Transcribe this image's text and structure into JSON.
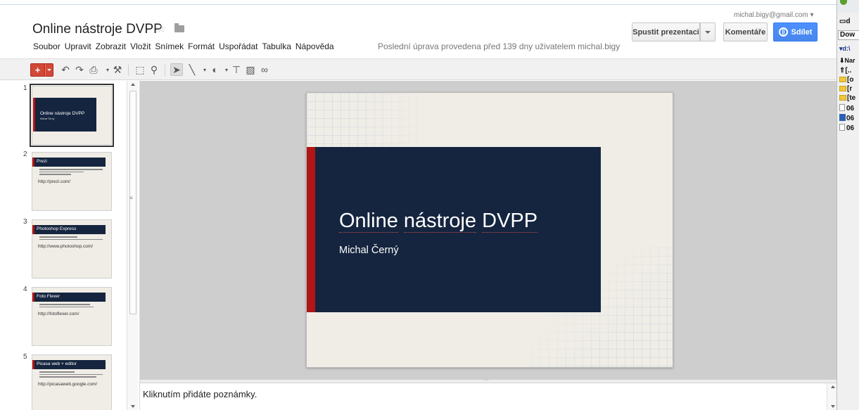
{
  "doc": {
    "title": "Online nástroje DVPP",
    "last_edit": "Poslední úprava provedena před 139 dny uživatelem michal.bigy"
  },
  "menu": [
    "Soubor",
    "Upravit",
    "Zobrazit",
    "Vložit",
    "Snímek",
    "Formát",
    "Uspořádat",
    "Tabulka",
    "Nápověda"
  ],
  "account": {
    "email": "michal.bigy@gmail.com ▾"
  },
  "buttons": {
    "present": "Spustit prezentaci",
    "comments": "Komentáře",
    "share": "Sdílet"
  },
  "toolbar_icons": [
    "new-slide-icon",
    "undo-icon",
    "redo-icon",
    "paint-format-icon",
    "zoom-icon",
    "select-cursor-icon",
    "line-icon",
    "shape-icon",
    "textbox-icon",
    "image-icon",
    "link-icon"
  ],
  "slides": [
    {
      "num": "1",
      "title": "Online nástroje DVPP",
      "subtitle": "Michal Černý"
    },
    {
      "num": "2",
      "title": "Prezi",
      "link": "http://prezi.com/"
    },
    {
      "num": "3",
      "title": "Photoshop Express",
      "link": "http://www.photoshop.com/"
    },
    {
      "num": "4",
      "title": "Foto Flexer",
      "link": "http://fotoflexer.com/"
    },
    {
      "num": "5",
      "title": "Picasa web + editor",
      "link": "http://picasaweb.google.com/"
    }
  ],
  "current_slide": {
    "title_part1": "Online",
    "title_part2": "nástroje",
    "title_part3": "DVPP",
    "subtitle": "Michal Černý"
  },
  "notes": {
    "placeholder": "Kliknutím přidáte poznámky."
  },
  "colors": {
    "slide_navy": "#15253f",
    "slide_red": "#b21515",
    "slide_bg": "#efede6",
    "share_blue": "#4d90fe",
    "new_red": "#d14836"
  },
  "side_panel": {
    "rows": [
      "d",
      "Dow",
      "▾d:\\",
      "⬇Nar",
      "[..",
      "[o",
      "[r",
      "[te",
      "06",
      "06",
      "06"
    ]
  }
}
